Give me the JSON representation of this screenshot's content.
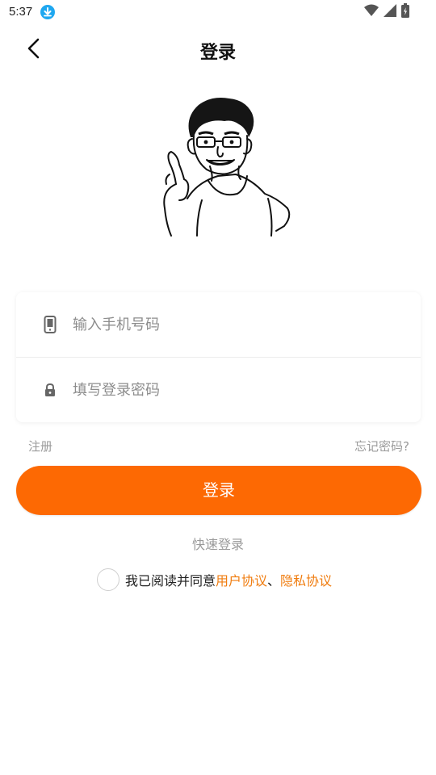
{
  "status_bar": {
    "time": "5:37",
    "icons": [
      "download-icon",
      "wifi-icon",
      "cell-signal-icon",
      "battery-icon"
    ]
  },
  "header": {
    "title": "登录",
    "back_icon": "chevron-left-icon"
  },
  "avatar": {
    "description_icon": "cartoon-avatar-icon"
  },
  "form": {
    "phone": {
      "icon": "phone-icon",
      "placeholder": "输入手机号码",
      "value": ""
    },
    "password": {
      "icon": "lock-icon",
      "placeholder": "填写登录密码",
      "value": ""
    }
  },
  "links": {
    "register": "注册",
    "forgot_password": "忘记密码?"
  },
  "login_button": {
    "label": "登录"
  },
  "quick_login": {
    "label": "快速登录"
  },
  "agreement": {
    "prefix": "我已阅读并同意",
    "user_agreement": "用户协议",
    "separator": "、",
    "privacy_agreement": "隐私协议",
    "checked": false
  },
  "colors": {
    "accent": "#fd6903",
    "link": "#f07d10",
    "muted_text": "#9a9a9a",
    "download_badge": "#1ea7f0"
  }
}
